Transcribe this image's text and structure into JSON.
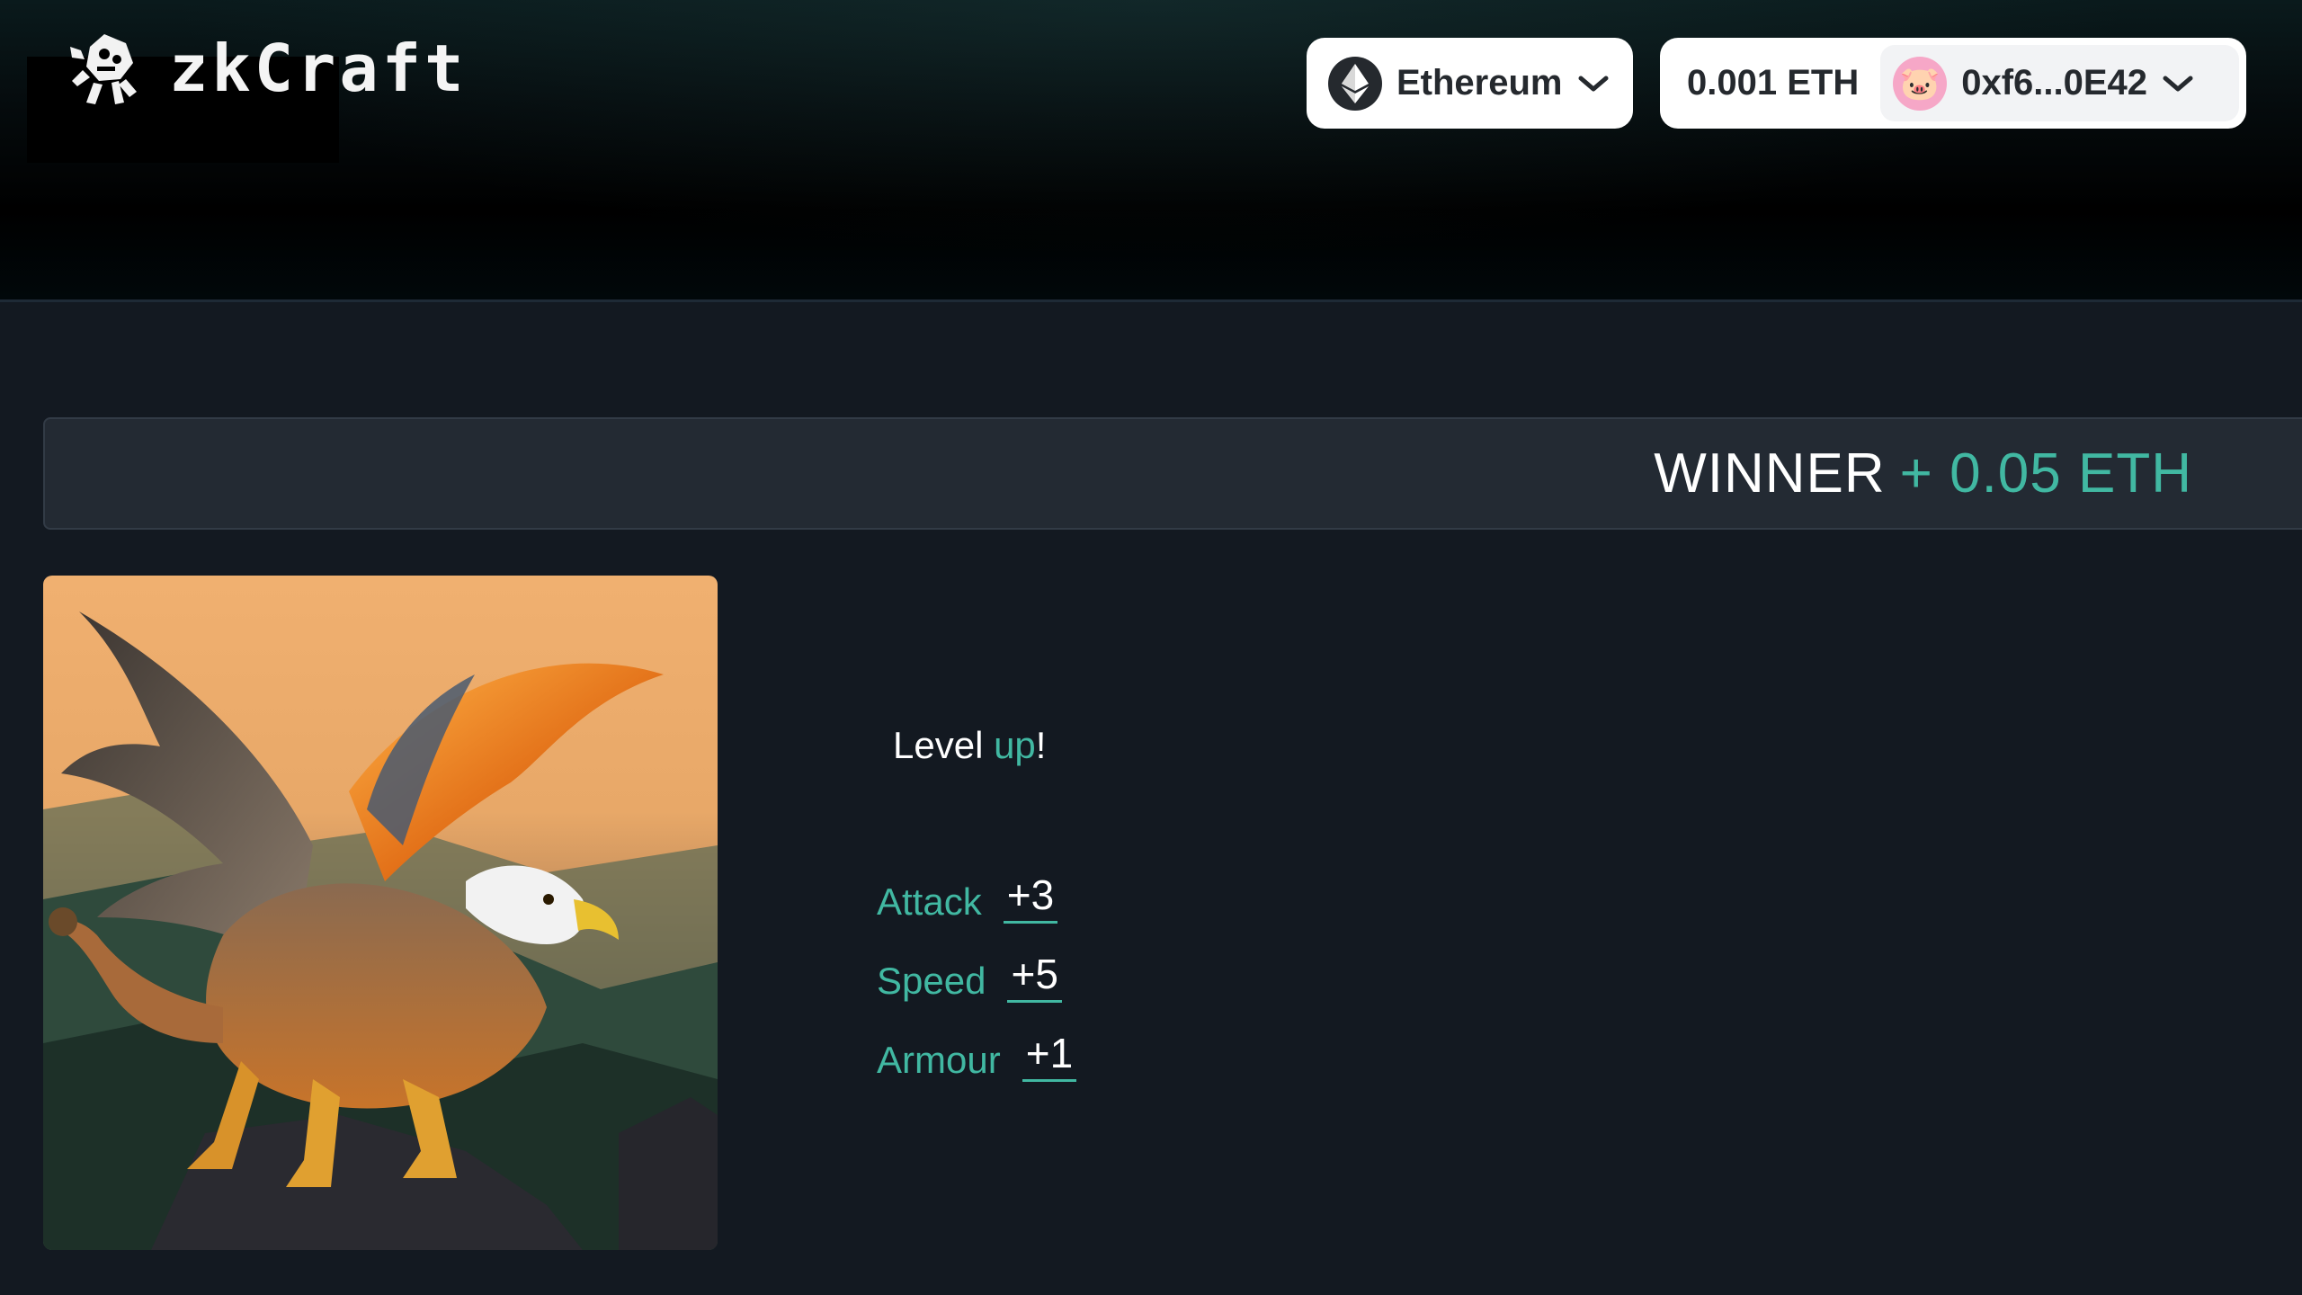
{
  "header": {
    "app_name": "zkCraft",
    "network": {
      "label": "Ethereum",
      "icon": "ethereum-icon"
    },
    "account": {
      "balance": "0.001 ETH",
      "address": "0xf6...0E42",
      "avatar_emoji": "🐷"
    }
  },
  "winner": {
    "label": "WINNER",
    "amount": "+ 0.05 ETH"
  },
  "card": {
    "image": "griffin-artwork"
  },
  "levelup": {
    "title_prefix": "Level",
    "title_accent": "up",
    "title_suffix": "!"
  },
  "stats": [
    {
      "label": "Attack",
      "value": "+3"
    },
    {
      "label": "Speed",
      "value": "+5"
    },
    {
      "label": "Armour",
      "value": "+1"
    }
  ],
  "colors": {
    "accent": "#41b8a2",
    "background": "#131921",
    "bar": "#232a33"
  }
}
